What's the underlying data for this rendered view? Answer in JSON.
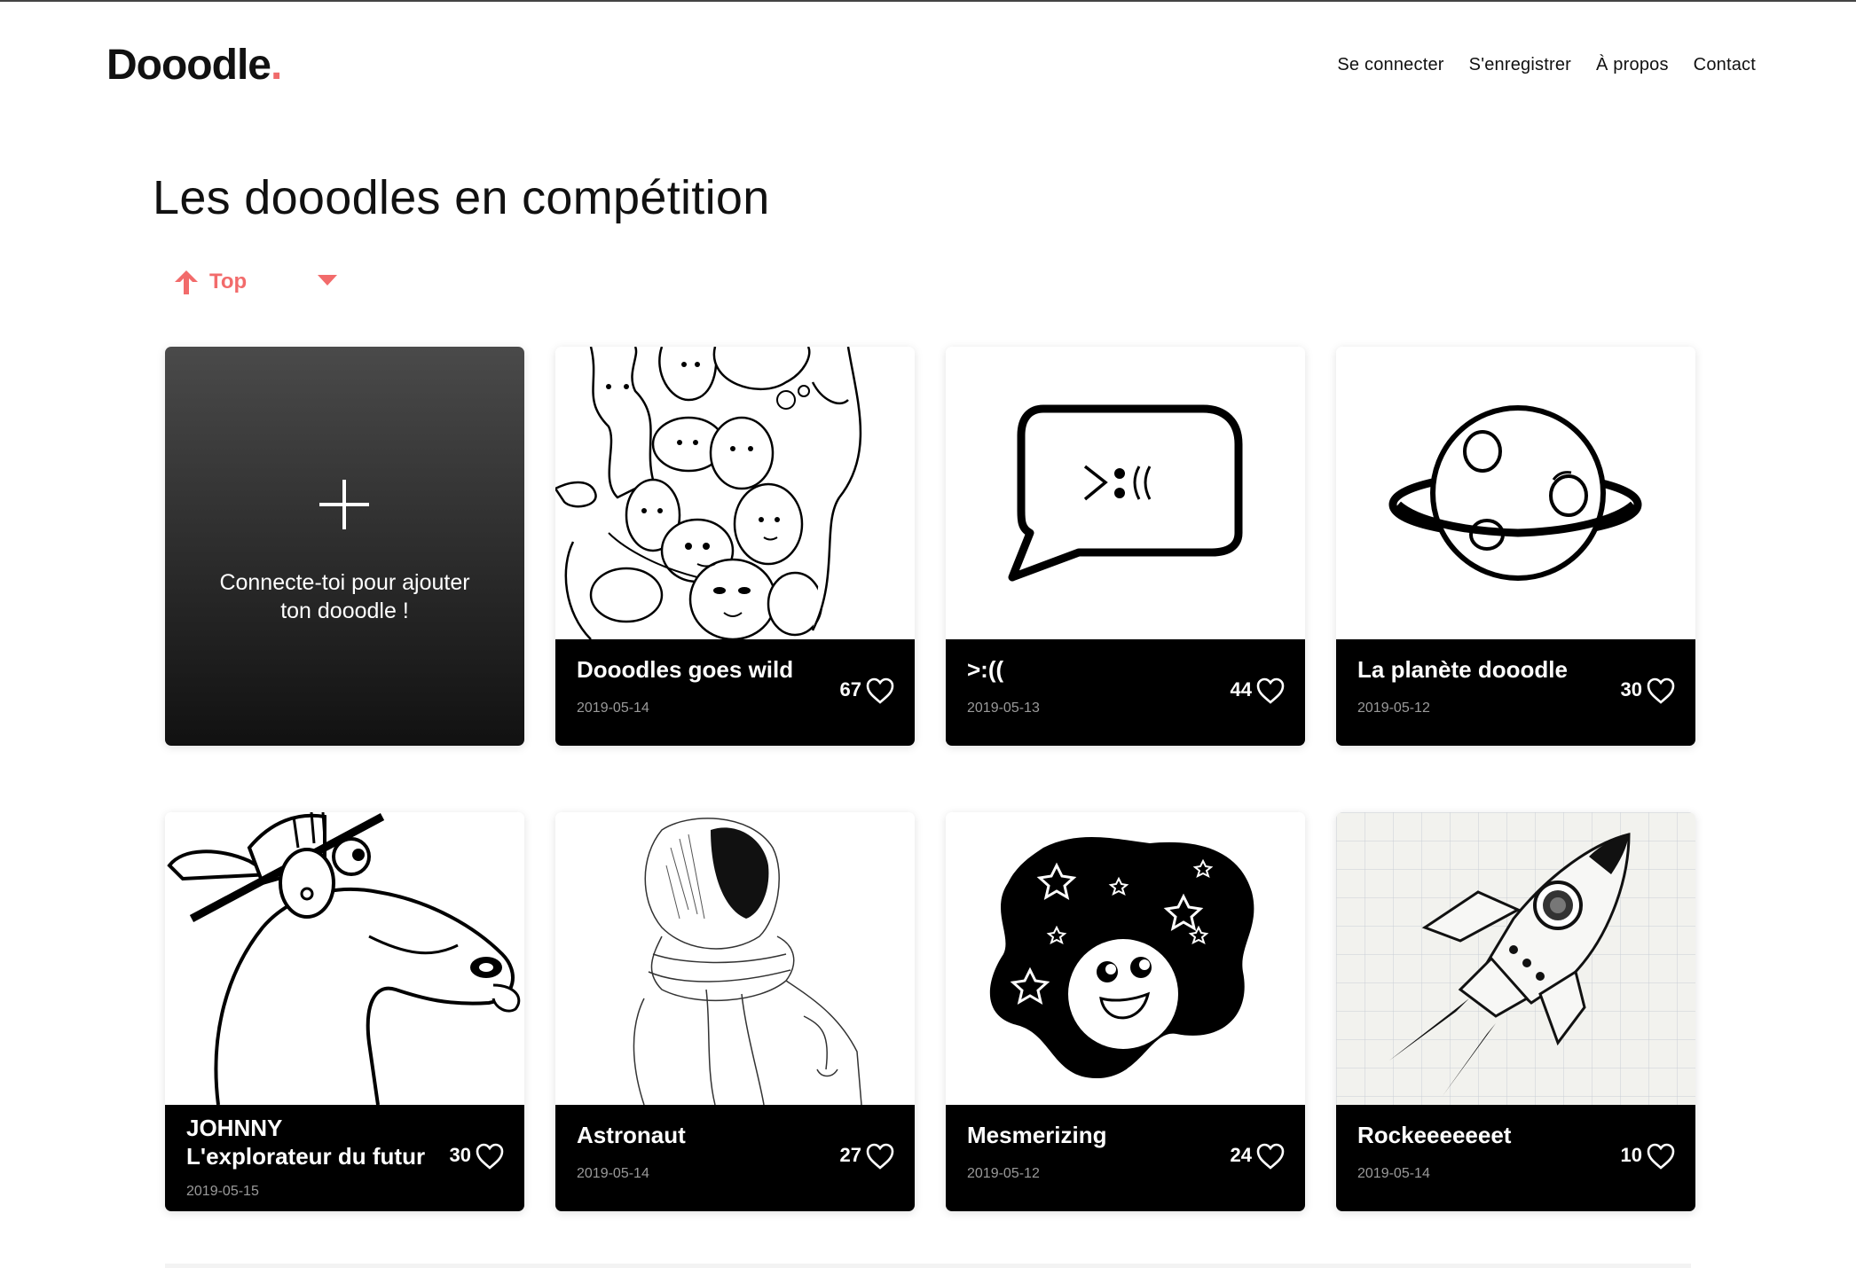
{
  "header": {
    "logo_text": "Dooodle",
    "logo_dot": ".",
    "nav": [
      "Se connecter",
      "S'enregistrer",
      "À propos",
      "Contact"
    ]
  },
  "page_title": "Les dooodles en compétition",
  "sort": {
    "label": "Top",
    "icon": "arrow-up-icon",
    "dropdown_icon": "caret-down-icon"
  },
  "add_card": {
    "icon": "plus-icon",
    "message_line1": "Connecte-toi pour ajouter",
    "message_line2": "ton dooodle !"
  },
  "cards": [
    {
      "title": "Dooodles goes wild",
      "date": "2019-05-14",
      "likes": "67",
      "illustration": "monsters-doodle"
    },
    {
      "title": ">:((",
      "date": "2019-05-13",
      "likes": "44",
      "illustration": "speech-bubble"
    },
    {
      "title": "La planète dooodle",
      "date": "2019-05-12",
      "likes": "30",
      "illustration": "planet"
    },
    {
      "title_line1": "JOHNNY",
      "title_line2": "L'explorateur du futur",
      "date": "2019-05-15",
      "likes": "30",
      "illustration": "llama-with-hat"
    },
    {
      "title": "Astronaut",
      "date": "2019-05-14",
      "likes": "27",
      "illustration": "astronaut-sketch"
    },
    {
      "title": "Mesmerizing",
      "date": "2019-05-12",
      "likes": "24",
      "illustration": "space-blob"
    },
    {
      "title": "Rockeeeeeeet",
      "date": "2019-05-14",
      "likes": "10",
      "illustration": "rocket"
    }
  ],
  "colors": {
    "accent": "#f26b6b",
    "card_footer": "#000000",
    "date_text": "#9a9a9a"
  }
}
